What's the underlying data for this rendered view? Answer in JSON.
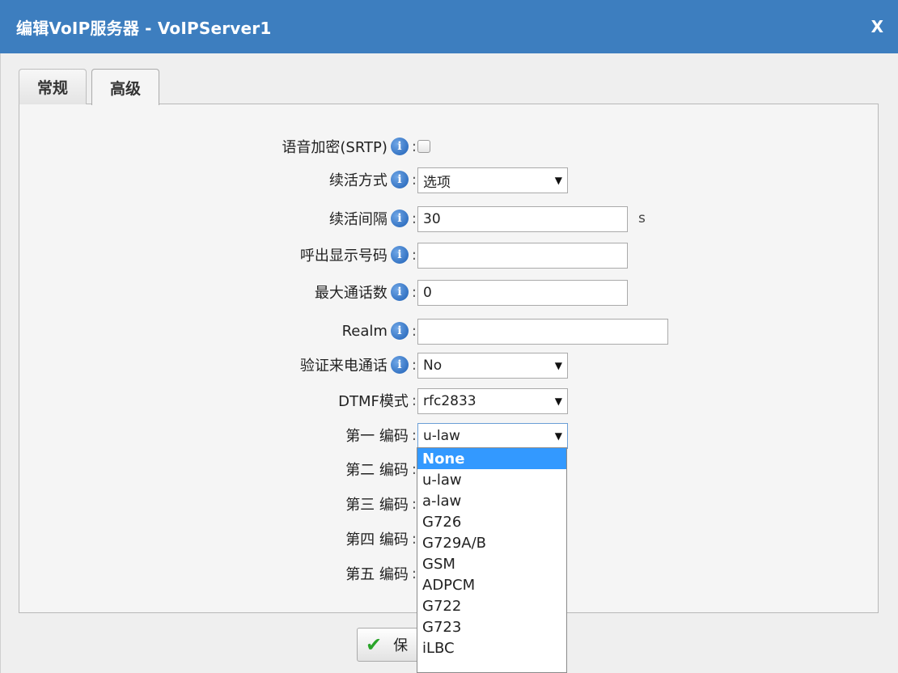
{
  "window": {
    "title": "编辑VoIP服务器 - VoIPServer1",
    "close_label": "X"
  },
  "tabs": [
    {
      "label": "常规",
      "active": false
    },
    {
      "label": "高级",
      "active": true
    }
  ],
  "form": {
    "srtp": {
      "label": "语音加密(SRTP)",
      "checked": false
    },
    "keepalive_mode": {
      "label": "续活方式",
      "value": "选项"
    },
    "keepalive_interval": {
      "label": "续活间隔",
      "value": "30",
      "unit": "s"
    },
    "outbound_callerid": {
      "label": "呼出显示号码",
      "value": ""
    },
    "max_calls": {
      "label": "最大通话数",
      "value": "0"
    },
    "realm": {
      "label": "Realm",
      "value": ""
    },
    "auth_incoming": {
      "label": "验证来电通话",
      "value": "No"
    },
    "dtmf_mode": {
      "label": "DTMF模式",
      "value": "rfc2833"
    },
    "codec1": {
      "label": "第一 编码",
      "value": "u-law"
    },
    "codec2": {
      "label": "第二 编码"
    },
    "codec3": {
      "label": "第三 编码"
    },
    "codec4": {
      "label": "第四 编码"
    },
    "codec5": {
      "label": "第五 编码"
    }
  },
  "dropdown": {
    "options": [
      "None",
      "u-law",
      "a-law",
      "G726",
      "G729A/B",
      "GSM",
      "ADPCM",
      "G722",
      "G723",
      "iLBC"
    ],
    "highlighted": "None"
  },
  "footer": {
    "save_label": "保"
  }
}
